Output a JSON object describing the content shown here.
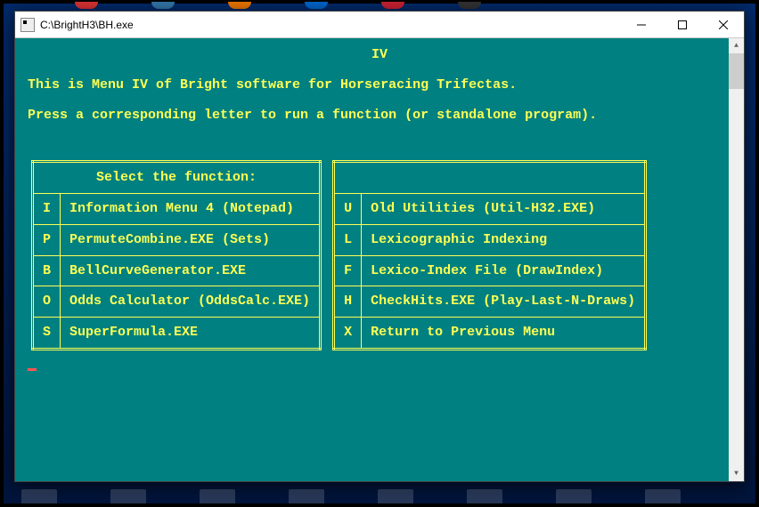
{
  "window": {
    "title": "C:\\BrightH3\\BH.exe"
  },
  "console": {
    "header": "IV",
    "line1": "This is Menu IV of Bright software for Horseracing Trifectas.",
    "line2": "Press a corresponding letter to run a function (or standalone program).",
    "tableHeader": "Select the function:",
    "left": [
      {
        "key": "I",
        "desc": "Information Menu 4 (Notepad)"
      },
      {
        "key": "P",
        "desc": "PermuteCombine.EXE (Sets)"
      },
      {
        "key": "B",
        "desc": "BellCurveGenerator.EXE"
      },
      {
        "key": "O",
        "desc": "Odds Calculator (OddsCalc.EXE)"
      },
      {
        "key": "S",
        "desc": "SuperFormula.EXE"
      }
    ],
    "right": [
      {
        "key": "U",
        "desc": "Old Utilities (Util-H32.EXE)"
      },
      {
        "key": "L",
        "desc": "Lexicographic Indexing"
      },
      {
        "key": "F",
        "desc": "Lexico-Index File (DrawIndex)"
      },
      {
        "key": "H",
        "desc": "CheckHits.EXE (Play-Last-N-Draws)"
      },
      {
        "key": "X",
        "desc": "Return to Previous Menu"
      }
    ]
  }
}
